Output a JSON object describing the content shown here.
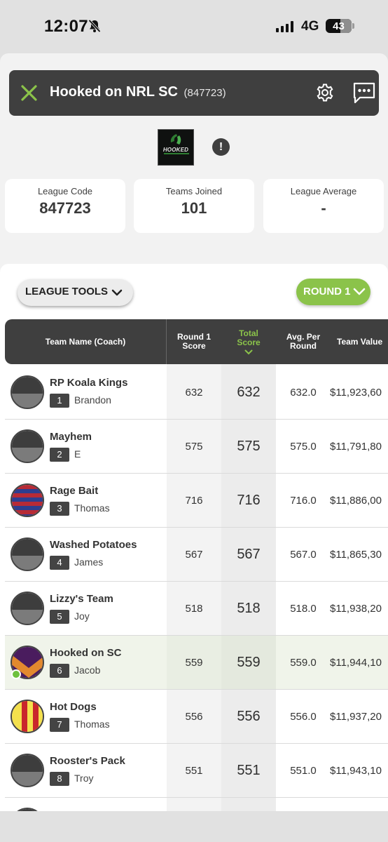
{
  "status_bar": {
    "time": "12:07",
    "network": "4G",
    "battery": "43",
    "battery_level": 0.43
  },
  "header": {
    "title": "Hooked on NRL SC",
    "league_id": "(847723)"
  },
  "logo": {
    "text": "HOOKED"
  },
  "alert": {
    "symbol": "!"
  },
  "stats": [
    {
      "label": "League Code",
      "value": "847723"
    },
    {
      "label": "Teams Joined",
      "value": "101"
    },
    {
      "label": "League Average",
      "value": "-"
    }
  ],
  "toolbar": {
    "tools_label": "LEAGUE TOOLS",
    "round_label": "ROUND 1"
  },
  "table": {
    "headers": {
      "team": "Team Name (Coach)",
      "round_score": "Round 1 Score",
      "total": "Total Score",
      "avg": "Avg. Per Round",
      "value": "Team Value"
    },
    "rows": [
      {
        "name": "RP Koala Kings",
        "rank": "1",
        "coach": "Brandon",
        "round": "632",
        "total": "632",
        "avg": "632.0",
        "value": "$11,923,60",
        "avatar": "grey"
      },
      {
        "name": "Mayhem",
        "rank": "2",
        "coach": "E",
        "round": "575",
        "total": "575",
        "avg": "575.0",
        "value": "$11,791,80",
        "avatar": "grey"
      },
      {
        "name": "Rage Bait",
        "rank": "3",
        "coach": "Thomas",
        "round": "716",
        "total": "716",
        "avg": "716.0",
        "value": "$11,886,00",
        "avatar": "hoops"
      },
      {
        "name": "Washed Potatoes",
        "rank": "4",
        "coach": "James",
        "round": "567",
        "total": "567",
        "avg": "567.0",
        "value": "$11,865,30",
        "avatar": "grey"
      },
      {
        "name": "Lizzy's Team",
        "rank": "5",
        "coach": "Joy",
        "round": "518",
        "total": "518",
        "avg": "518.0",
        "value": "$11,938,20",
        "avatar": "grey"
      },
      {
        "name": "Hooked on SC",
        "rank": "6",
        "coach": "Jacob",
        "round": "559",
        "total": "559",
        "avg": "559.0",
        "value": "$11,944,10",
        "avatar": "chevron"
      },
      {
        "name": "Hot Dogs",
        "rank": "7",
        "coach": "Thomas",
        "round": "556",
        "total": "556",
        "avg": "556.0",
        "value": "$11,937,20",
        "avatar": "stripes"
      },
      {
        "name": "Rooster's Pack",
        "rank": "8",
        "coach": "Troy",
        "round": "551",
        "total": "551",
        "avg": "551.0",
        "value": "$11,943,10",
        "avatar": "grey"
      }
    ],
    "highlight_rank": "6"
  },
  "colors": {
    "accent": "#8bc34a",
    "dark": "#3f3f3f",
    "online": "#6ec13f"
  }
}
